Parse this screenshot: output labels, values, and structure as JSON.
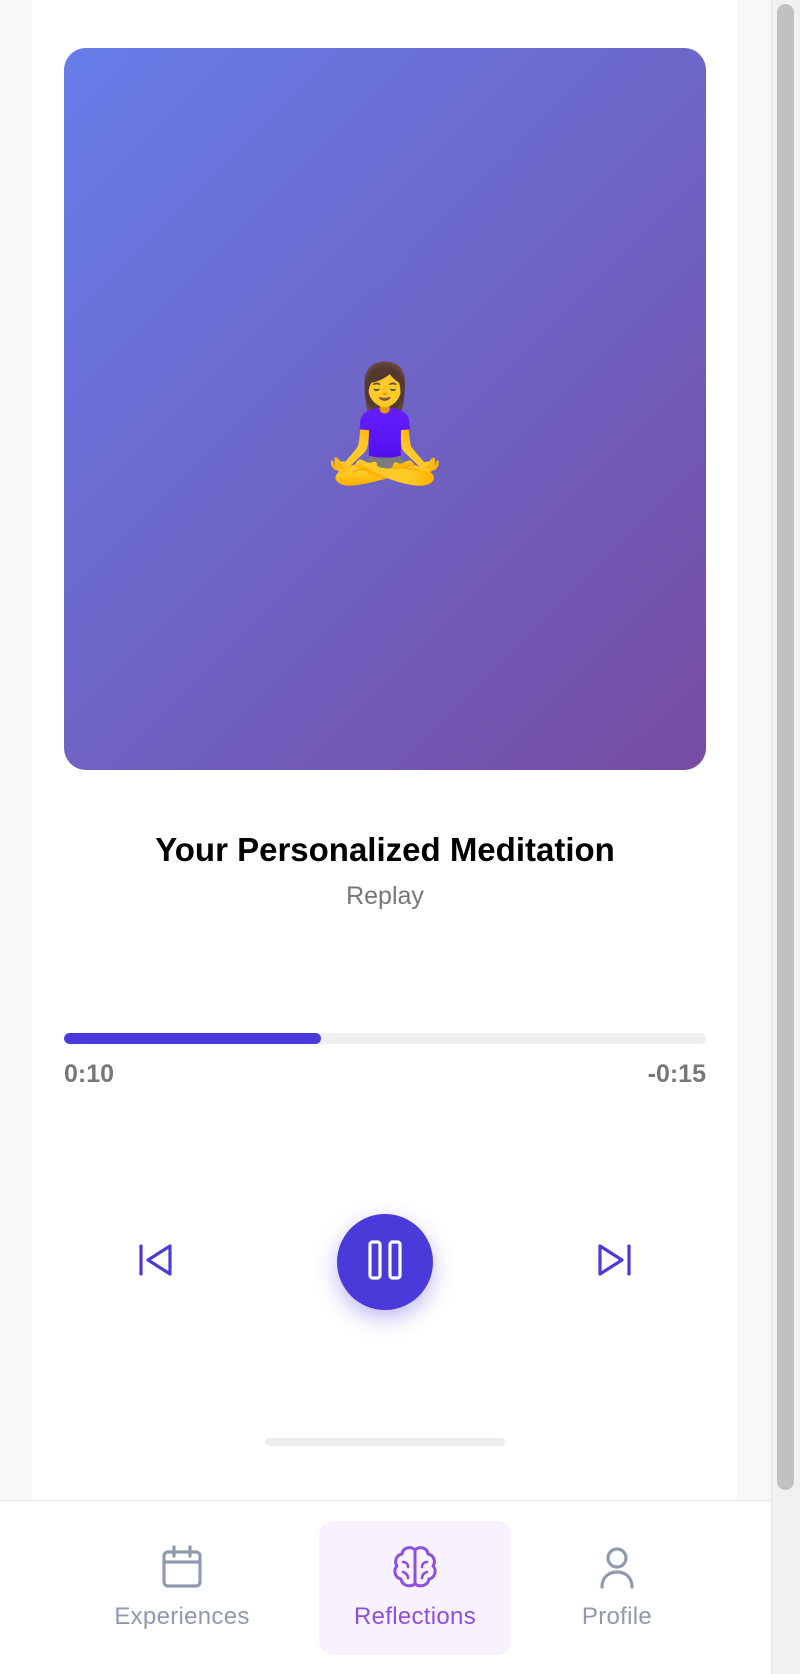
{
  "player": {
    "artwork_emoji": "🧘‍♀️",
    "title": "Your Personalized Meditation",
    "subtitle": "Replay",
    "progress_percent": 40,
    "time_elapsed": "0:10",
    "time_remaining": "-0:15"
  },
  "controls": {
    "previous_icon": "skip-back-icon",
    "play_pause_icon": "pause-icon",
    "next_icon": "skip-forward-icon"
  },
  "nav": {
    "items": [
      {
        "label": "Experiences",
        "icon": "calendar-icon",
        "active": false
      },
      {
        "label": "Reflections",
        "icon": "brain-icon",
        "active": true
      },
      {
        "label": "Profile",
        "icon": "user-icon",
        "active": false
      }
    ]
  },
  "colors": {
    "accent": "#4a3ad9",
    "gradient_start": "#667eea",
    "gradient_end": "#764ba2",
    "nav_active": "#8e4ee0",
    "nav_inactive": "#8f9aae"
  }
}
